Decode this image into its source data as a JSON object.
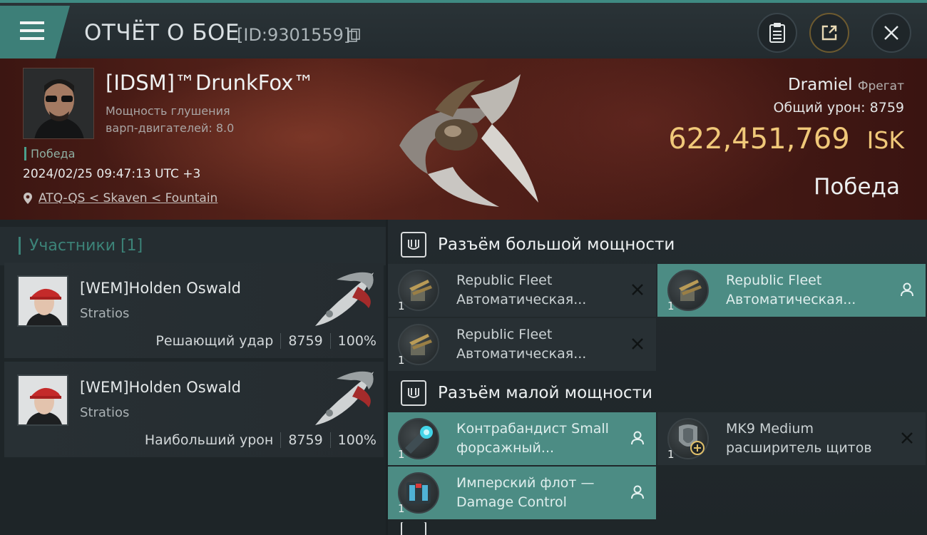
{
  "header": {
    "title": "ОТЧЁТ О БОЕ",
    "report_id": "[ID:9301559]"
  },
  "victim": {
    "pilot": "[IDSM]™DrunkFox™",
    "warp_disruption_label": "Мощность глушения варп-двигателей: 8.0",
    "result_left": "Победа",
    "timestamp": "2024/02/25 09:47:13 UTC +3",
    "location": "ATQ-QS < Skaven < Fountain",
    "ship_name": "Dramiel",
    "ship_class": "Фрегат",
    "damage_label": "Общий урон:",
    "damage_value": "8759",
    "isk_value": "622,451,769",
    "isk_unit": "ISK",
    "result_right": "Победа"
  },
  "participants": {
    "title": "Участники [1]",
    "cards": [
      {
        "name": "[WEM]Holden Oswald",
        "ship": "Stratios",
        "role": "Решающий удар",
        "damage": "8759",
        "percent": "100%"
      },
      {
        "name": "[WEM]Holden Oswald",
        "ship": "Stratios",
        "role": "Наибольший урон",
        "damage": "8759",
        "percent": "100%"
      }
    ]
  },
  "fitting": {
    "high_slots_title": "Разъём большой мощности",
    "high_slots": [
      {
        "name": "Republic Fleet Автоматическая...",
        "line1": "Republic Fleet",
        "line2": "Автоматическая...",
        "qty": "1",
        "state": "destroyed"
      },
      {
        "name": "Republic Fleet Автоматическая...",
        "line1": "Republic Fleet",
        "line2": "Автоматическая...",
        "qty": "1",
        "state": "dropped"
      },
      {
        "name": "Republic Fleet Автоматическая...",
        "line1": "Republic Fleet",
        "line2": "Автоматическая...",
        "qty": "1",
        "state": "destroyed"
      }
    ],
    "low_slots_title": "Разъём малой мощности",
    "low_slots": [
      {
        "line1": "Контрабандист Small",
        "line2": "форсажный...",
        "qty": "1",
        "state": "dropped"
      },
      {
        "line1": "MK9 Medium",
        "line2": "расширитель щитов",
        "qty": "1",
        "state": "destroyed"
      },
      {
        "line1": "Имперский флот —",
        "line2": "Damage Control",
        "qty": "1",
        "state": "dropped"
      }
    ]
  },
  "colors": {
    "accent": "#3d7f78",
    "isk": "#f0c879",
    "active_slot": "#4c8c84"
  },
  "icons": {
    "menu": "menu-icon",
    "copy": "copy-icon",
    "clipboard": "clipboard-icon",
    "share": "share-icon",
    "close": "close-icon",
    "location": "location-pin-icon",
    "slot_section": "slot-section-icon",
    "destroyed": "close-icon",
    "dropped": "user-icon"
  }
}
